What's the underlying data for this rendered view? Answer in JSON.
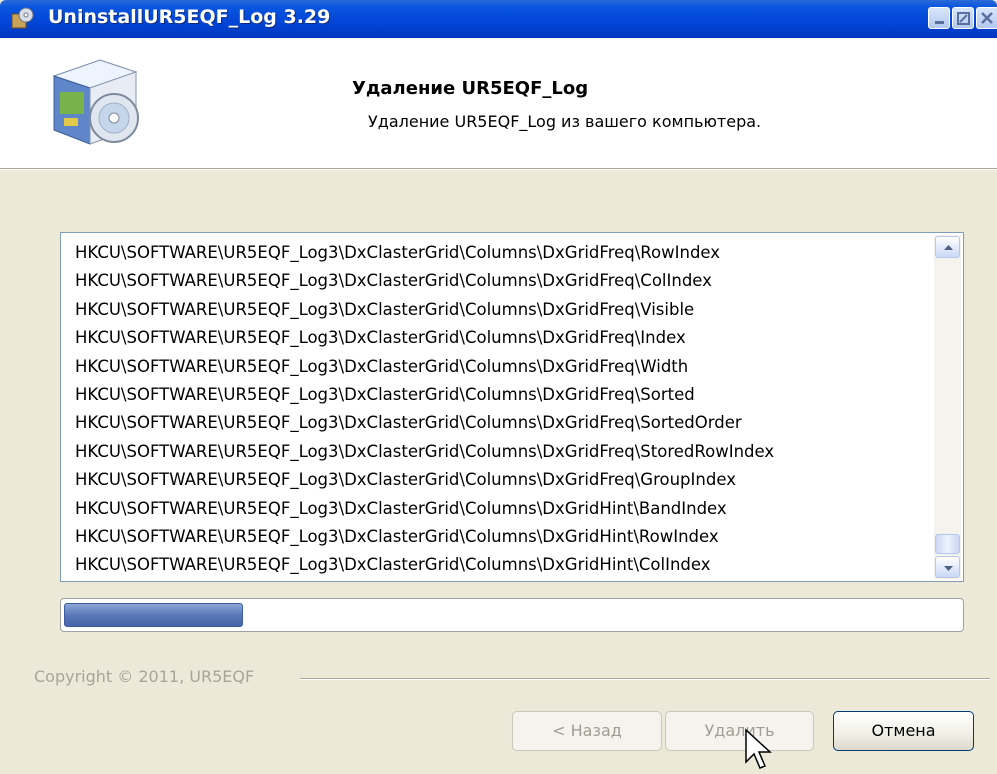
{
  "window": {
    "title": "UninstallUR5EQF_Log 3.29"
  },
  "header": {
    "title": "Удаление UR5EQF_Log",
    "subtitle": "Удаление UR5EQF_Log из вашего компьютера."
  },
  "log": {
    "lines": [
      "HKCU\\SOFTWARE\\UR5EQF_Log3\\DxClasterGrid\\Columns\\DxGridFreq\\RowIndex",
      "HKCU\\SOFTWARE\\UR5EQF_Log3\\DxClasterGrid\\Columns\\DxGridFreq\\ColIndex",
      "HKCU\\SOFTWARE\\UR5EQF_Log3\\DxClasterGrid\\Columns\\DxGridFreq\\Visible",
      "HKCU\\SOFTWARE\\UR5EQF_Log3\\DxClasterGrid\\Columns\\DxGridFreq\\Index",
      "HKCU\\SOFTWARE\\UR5EQF_Log3\\DxClasterGrid\\Columns\\DxGridFreq\\Width",
      "HKCU\\SOFTWARE\\UR5EQF_Log3\\DxClasterGrid\\Columns\\DxGridFreq\\Sorted",
      "HKCU\\SOFTWARE\\UR5EQF_Log3\\DxClasterGrid\\Columns\\DxGridFreq\\SortedOrder",
      "HKCU\\SOFTWARE\\UR5EQF_Log3\\DxClasterGrid\\Columns\\DxGridFreq\\StoredRowIndex",
      "HKCU\\SOFTWARE\\UR5EQF_Log3\\DxClasterGrid\\Columns\\DxGridFreq\\GroupIndex",
      "HKCU\\SOFTWARE\\UR5EQF_Log3\\DxClasterGrid\\Columns\\DxGridHint\\BandIndex",
      "HKCU\\SOFTWARE\\UR5EQF_Log3\\DxClasterGrid\\Columns\\DxGridHint\\RowIndex",
      "HKCU\\SOFTWARE\\UR5EQF_Log3\\DxClasterGrid\\Columns\\DxGridHint\\ColIndex"
    ]
  },
  "progress": {
    "fraction": 0.2
  },
  "footer": {
    "copyright": "Copyright © 2011, UR5EQF"
  },
  "buttons": {
    "back": "< Назад",
    "uninstall": "Удалить",
    "cancel": "Отмена"
  },
  "colors": {
    "titlebar": "#0346d8",
    "dialog_bg": "#ece9d8",
    "progress": "#5979b8"
  },
  "icons": [
    "installer-box-icon",
    "cd-disc-icon",
    "minimize-icon",
    "maximize-icon",
    "close-icon",
    "scroll-up-arrow-icon",
    "scroll-down-arrow-icon",
    "mouse-pointer-icon"
  ]
}
